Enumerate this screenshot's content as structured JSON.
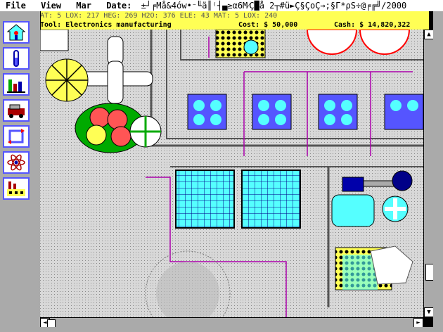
{
  "menu": {
    "file": "File",
    "view": "View",
    "mar": "Mar",
    "date_label": "Date:",
    "date_value": "±┘╒Må&4ów•⁻╙ä║⁽┤▄≥α6M⁄Ç█å 2┬#ü►Ç§ÇoÇ→;§Γ*ρS÷@╒╔╝/2000"
  },
  "status": {
    "resources": "AT: 5  LOX: 217  HEG: 269  H2O: 376  ELE: 43  MAT: 5  LOX: 240",
    "tool": "Tool: Electronics manufacturing",
    "cost": "Cost: $ 50,000",
    "cash": "Cash: $ 14,820,322"
  },
  "tools": [
    "build-icon",
    "test-tube-icon",
    "chart-icon",
    "vehicle-icon",
    "cycle-icon",
    "atom-icon",
    "factory-icon"
  ],
  "colors": {
    "status_bar": "#ffff55",
    "tool_border": "#5555ff",
    "map_bg": "#d8d8d8"
  }
}
